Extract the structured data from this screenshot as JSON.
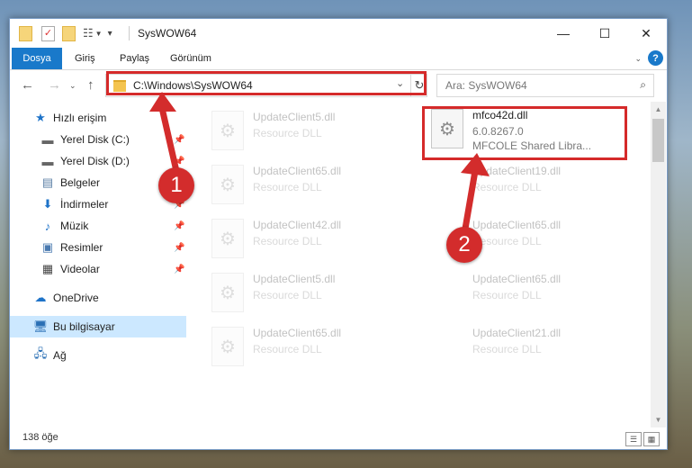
{
  "window": {
    "title": "SysWOW64",
    "controls": {
      "minimize": "—",
      "maximize": "☐",
      "close": "✕"
    }
  },
  "ribbon": {
    "file_tab": "Dosya",
    "tabs": [
      "Giriş",
      "Paylaş",
      "Görünüm"
    ],
    "help": "?"
  },
  "address": {
    "path": "C:\\Windows\\SysWOW64",
    "search_placeholder": "Ara: SysWOW64"
  },
  "sidebar": {
    "items": [
      {
        "label": "Hızlı erişim",
        "icon": "star-icon",
        "pinned": false
      },
      {
        "label": "Yerel Disk (C:)",
        "icon": "drive-icon",
        "pinned": true
      },
      {
        "label": "Yerel Disk (D:)",
        "icon": "drive-icon",
        "pinned": true
      },
      {
        "label": "Belgeler",
        "icon": "documents-icon",
        "pinned": true
      },
      {
        "label": "İndirmeler",
        "icon": "downloads-icon",
        "pinned": true
      },
      {
        "label": "Müzik",
        "icon": "music-icon",
        "pinned": true
      },
      {
        "label": "Resimler",
        "icon": "pictures-icon",
        "pinned": true
      },
      {
        "label": "Videolar",
        "icon": "videos-icon",
        "pinned": true
      },
      {
        "label": "OneDrive",
        "icon": "onedrive-icon",
        "pinned": false
      },
      {
        "label": "Bu bilgisayar",
        "icon": "computer-icon",
        "pinned": false
      },
      {
        "label": "Ağ",
        "icon": "network-icon",
        "pinned": false
      }
    ]
  },
  "files": {
    "highlighted": {
      "name": "mfco42d.dll",
      "version": "6.0.8267.0",
      "description": "MFCOLE Shared Libra..."
    },
    "ghost_left": [
      {
        "name": "UpdateClient5.dll",
        "type": "Resource DLL"
      },
      {
        "name": "UpdateClient65.dll",
        "type": "Resource DLL"
      },
      {
        "name": "UpdateClient42.dll",
        "type": "Resource DLL"
      },
      {
        "name": "UpdateClient5.dll",
        "type": "Resource DLL"
      },
      {
        "name": "UpdateClient65.dll",
        "type": "Resource DLL"
      }
    ],
    "ghost_right": [
      {
        "name": "UpdateClient19.dll",
        "type": "Resource DLL"
      },
      {
        "name": "UpdateClient65.dll",
        "type": "Resource DLL"
      },
      {
        "name": "UpdateClient65.dll",
        "type": "Resource DLL"
      },
      {
        "name": "UpdateClient21.dll",
        "type": "Resource DLL"
      }
    ]
  },
  "status": {
    "item_count": "138 öğe"
  },
  "callouts": [
    "1",
    "2"
  ],
  "colors": {
    "accent": "#1979ca",
    "highlight": "#d52a2a",
    "selected": "#cce8ff"
  }
}
